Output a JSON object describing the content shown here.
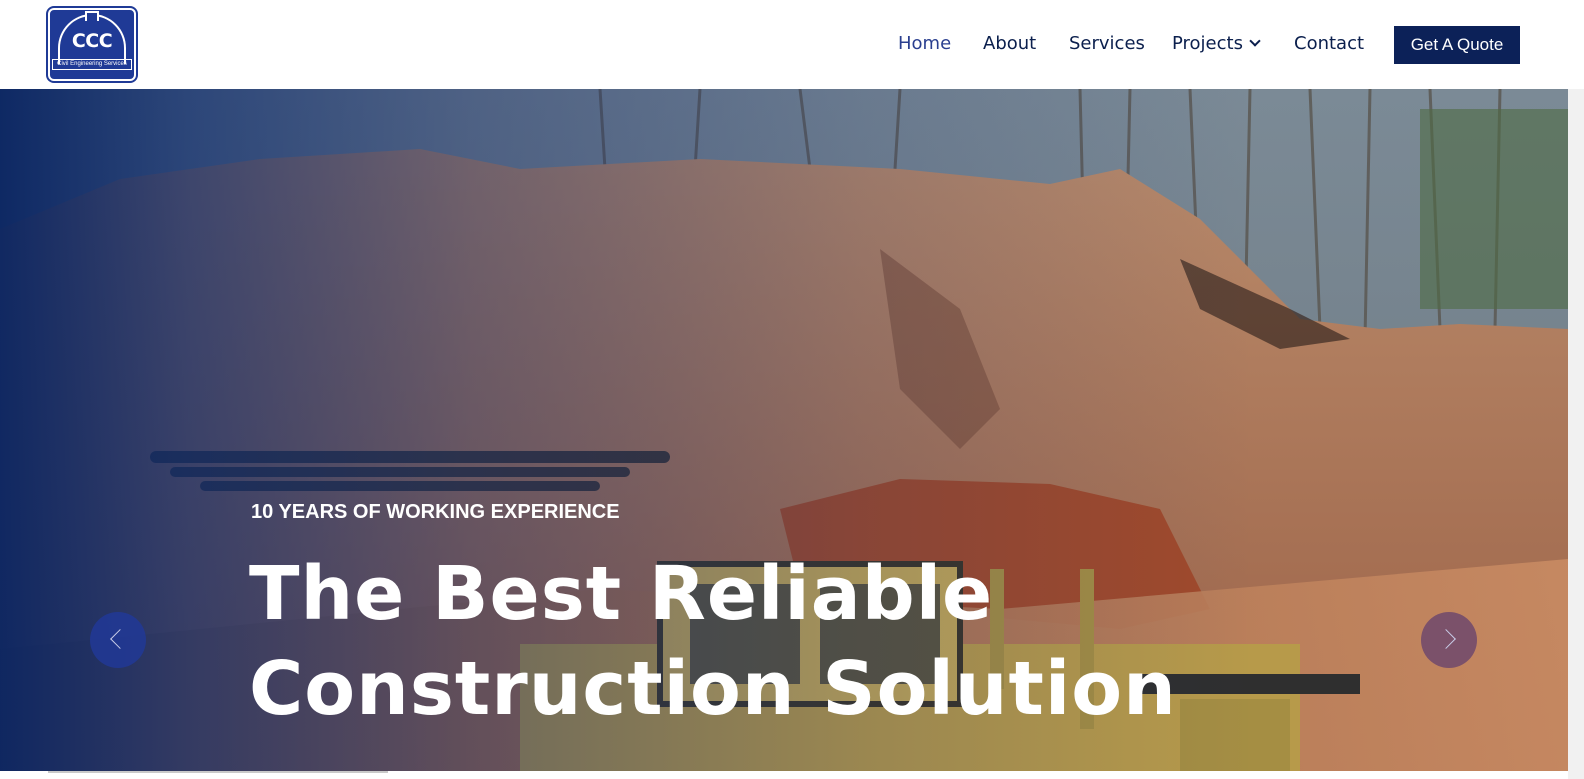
{
  "brand": {
    "logo_text": "CCC",
    "logo_subtitle": "Civil Engineering Services"
  },
  "nav": {
    "items": [
      {
        "label": "Home",
        "active": true
      },
      {
        "label": "About"
      },
      {
        "label": "Services"
      },
      {
        "label": "Projects",
        "has_dropdown": true
      },
      {
        "label": "Contact"
      }
    ],
    "cta_label": "Get A Quote"
  },
  "hero": {
    "eyebrow": "10 YEARS OF WORKING EXPERIENCE",
    "headline_line1": "The Best Reliable",
    "headline_line2": "Construction Solution",
    "prev_icon": "chevron-left-icon",
    "next_icon": "chevron-right-icon"
  },
  "colors": {
    "brand_navy": "#0c2158",
    "logo_blue": "#1f3a96",
    "nav_text": "#0b1f4d"
  }
}
